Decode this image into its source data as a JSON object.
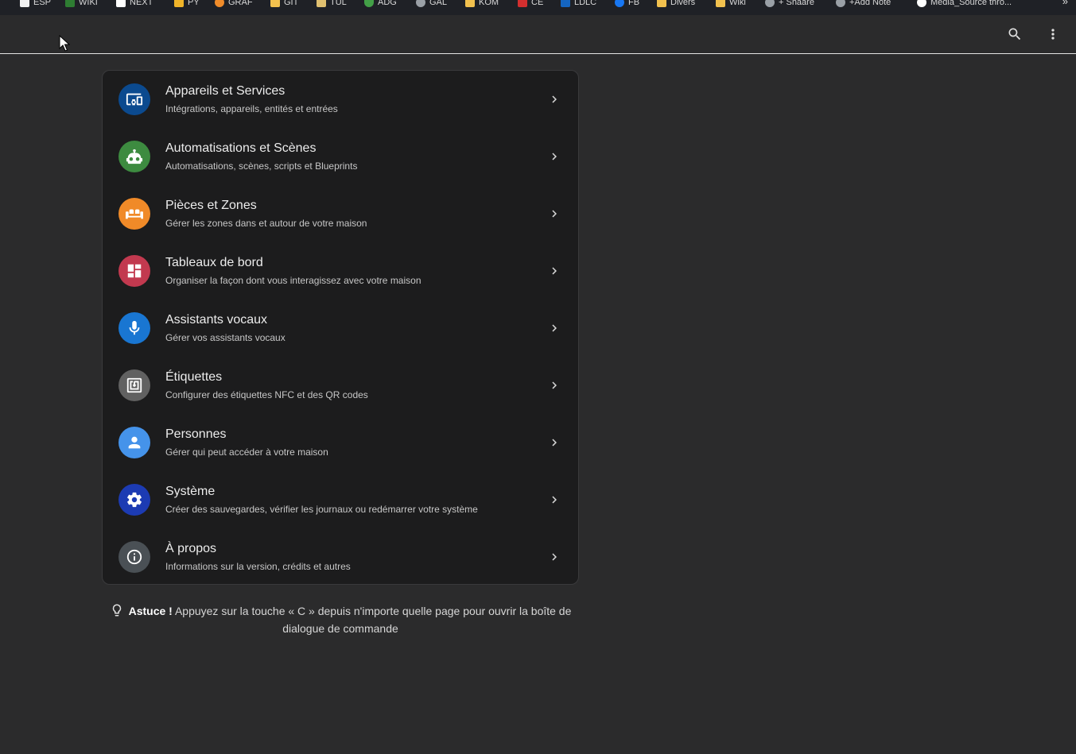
{
  "bookmarks": [
    {
      "label": "ESP",
      "icon": "page-icon",
      "color": "#f0f0f0"
    },
    {
      "label": "WIKI",
      "icon": "wiki-icon",
      "color": "#2e7d32"
    },
    {
      "label": "NEXT",
      "icon": "page-icon",
      "color": "#ffffff"
    },
    {
      "label": "PY",
      "icon": "python-icon",
      "color": "#f0b429"
    },
    {
      "label": "GRAF",
      "icon": "gear-icon",
      "color": "#f08c2a"
    },
    {
      "label": "GIT",
      "icon": "folder-icon",
      "color": "#f2c14e"
    },
    {
      "label": "TUL",
      "icon": "tool-icon",
      "color": "#e0c070"
    },
    {
      "label": "ADG",
      "icon": "shield-icon",
      "color": "#43a047"
    },
    {
      "label": "GAL",
      "icon": "globe-icon",
      "color": "#9aa0a6"
    },
    {
      "label": "KOM",
      "icon": "folder-icon",
      "color": "#f2c14e"
    },
    {
      "label": "CE",
      "icon": "ce-icon",
      "color": "#d32f2f"
    },
    {
      "label": "LDLC",
      "icon": "ldlc-icon",
      "color": "#1565c0"
    },
    {
      "label": "FB",
      "icon": "facebook-icon",
      "color": "#1877f2"
    },
    {
      "label": "Divers",
      "icon": "folder-icon",
      "color": "#f2c14e"
    },
    {
      "label": "Wiki",
      "icon": "folder-icon",
      "color": "#f2c14e"
    },
    {
      "label": "+ Shaare",
      "icon": "globe-icon",
      "color": "#9aa0a6"
    },
    {
      "label": "+Add Note",
      "icon": "globe-icon",
      "color": "#9aa0a6"
    },
    {
      "label": "Media_Source thro...",
      "icon": "github-icon",
      "color": "#ffffff"
    }
  ],
  "menu": [
    {
      "title": "Appareils et Services",
      "subtitle": "Intégrations, appareils, entités et entrées",
      "icon": "devices-icon",
      "color": "#0b4a8f"
    },
    {
      "title": "Automatisations et Scènes",
      "subtitle": "Automatisations, scènes, scripts et Blueprints",
      "icon": "robot-icon",
      "color": "#3d8b40"
    },
    {
      "title": "Pièces et Zones",
      "subtitle": "Gérer les zones dans et autour de votre maison",
      "icon": "sofa-icon",
      "color": "#f08a28"
    },
    {
      "title": "Tableaux de bord",
      "subtitle": "Organiser la façon dont vous interagissez avec votre maison",
      "icon": "dashboard-icon",
      "color": "#c2394f"
    },
    {
      "title": "Assistants vocaux",
      "subtitle": "Gérer vos assistants vocaux",
      "icon": "microphone-icon",
      "color": "#1976d2"
    },
    {
      "title": "Étiquettes",
      "subtitle": "Configurer des étiquettes NFC et des QR codes",
      "icon": "nfc-icon",
      "color": "#616161"
    },
    {
      "title": "Personnes",
      "subtitle": "Gérer qui peut accéder à votre maison",
      "icon": "person-icon",
      "color": "#4593ea"
    },
    {
      "title": "Système",
      "subtitle": "Créer des sauvegardes, vérifier les journaux ou redémarrer votre système",
      "icon": "cog-icon",
      "color": "#1c3bb3"
    },
    {
      "title": "À propos",
      "subtitle": "Informations sur la version, crédits et autres",
      "icon": "info-icon",
      "color": "#4a5055"
    }
  ],
  "tip": {
    "label": "Astuce !",
    "text": "Appuyez sur la touche « C » depuis n'importe quelle page pour ouvrir la boîte de dialogue de commande"
  }
}
